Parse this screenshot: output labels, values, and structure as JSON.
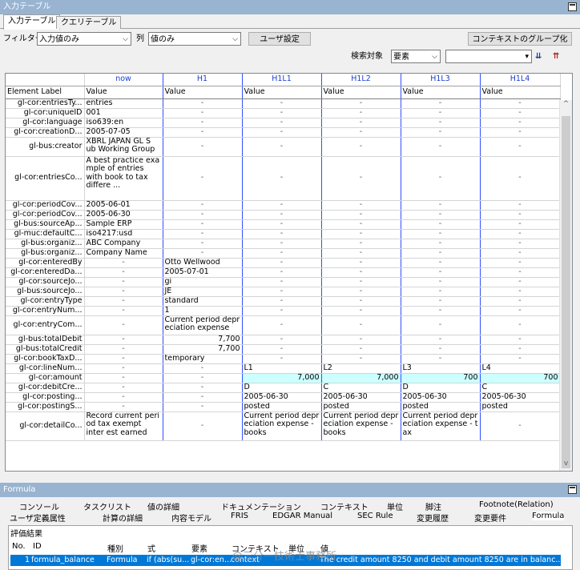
{
  "input_pane": {
    "title": "入力テーブル",
    "tabs": [
      "入力テーブル",
      "クエリテーブル"
    ],
    "filter_label": "フィルター",
    "filter_value": "入力値のみ",
    "column_label": "列",
    "column_value": "値のみ",
    "user_settings_button": "ユーザ設定",
    "context_group_button": "コンテキストのグループ化",
    "search_target_label": "検索対象",
    "search_target_value": "要素",
    "search_value": ""
  },
  "grid": {
    "top_headers": [
      "",
      "now",
      "H1",
      "H1L1",
      "H1L2",
      "H1L3",
      "H1L4"
    ],
    "sub_headers": [
      "Element Label",
      "Value",
      "Value",
      "Value",
      "Value",
      "Value",
      "Value"
    ],
    "rows": [
      {
        "label": "gl-cor:entriesTy...",
        "cells": [
          "entries",
          "-",
          "-",
          "-",
          "-",
          "-"
        ]
      },
      {
        "label": "gl-cor:uniqueID",
        "cells": [
          "001",
          "-",
          "-",
          "-",
          "-",
          "-"
        ]
      },
      {
        "label": "gl-cor:language",
        "cells": [
          "iso639:en",
          "-",
          "-",
          "-",
          "-",
          "-"
        ]
      },
      {
        "label": "gl-cor:creationD...",
        "cells": [
          "2005-07-05",
          "-",
          "-",
          "-",
          "-",
          "-"
        ]
      },
      {
        "label": "gl-bus:creator",
        "cells": [
          "XBRL JAPAN GL S ub Working Group",
          "-",
          "-",
          "-",
          "-",
          "-"
        ]
      },
      {
        "label": "gl-cor:entriesCo...",
        "cells": [
          "A best practice exa mple of entries with book to tax differe ...",
          "-",
          "-",
          "-",
          "-",
          "-"
        ]
      },
      {
        "label": "gl-cor:periodCov...",
        "cells": [
          "2005-06-01",
          "-",
          "-",
          "-",
          "-",
          "-"
        ]
      },
      {
        "label": "gl-cor:periodCov...",
        "cells": [
          "2005-06-30",
          "-",
          "-",
          "-",
          "-",
          "-"
        ]
      },
      {
        "label": "gl-bus:sourceAp...",
        "cells": [
          "Sample ERP",
          "-",
          "-",
          "-",
          "-",
          "-"
        ]
      },
      {
        "label": "gl-muc:defaultC...",
        "cells": [
          "iso4217:usd",
          "-",
          "-",
          "-",
          "-",
          "-"
        ]
      },
      {
        "label": "gl-bus:organiz...",
        "cells": [
          "ABC Company",
          "-",
          "-",
          "-",
          "-",
          "-"
        ]
      },
      {
        "label": "gl-bus:organiz...",
        "cells": [
          "Company Name",
          "-",
          "-",
          "-",
          "-",
          "-"
        ]
      },
      {
        "label": "gl-cor:enteredBy",
        "cells": [
          "-",
          "Otto Wellwood",
          "-",
          "-",
          "-",
          "-"
        ]
      },
      {
        "label": "gl-cor:enteredDa...",
        "cells": [
          "-",
          "2005-07-01",
          "-",
          "-",
          "-",
          "-"
        ]
      },
      {
        "label": "gl-cor:sourceJo...",
        "cells": [
          "-",
          "gi",
          "-",
          "-",
          "-",
          "-"
        ]
      },
      {
        "label": "gl-bus:sourceJo...",
        "cells": [
          "-",
          "JE",
          "-",
          "-",
          "-",
          "-"
        ]
      },
      {
        "label": "gl-cor:entryType",
        "cells": [
          "-",
          "standard",
          "-",
          "-",
          "-",
          "-"
        ]
      },
      {
        "label": "gl-cor:entryNum...",
        "cells": [
          "-",
          "1",
          "-",
          "-",
          "-",
          "-"
        ]
      },
      {
        "label": "gl-cor:entryCom...",
        "cells": [
          "-",
          "Current period depr eciation expense",
          "-",
          "-",
          "-",
          "-"
        ]
      },
      {
        "label": "gl-bus:totalDebit",
        "cells": [
          "-",
          "7,700",
          "-",
          "-",
          "-",
          "-"
        ]
      },
      {
        "label": "gl-bus:totalCredit",
        "cells": [
          "-",
          "7,700",
          "-",
          "-",
          "-",
          "-"
        ]
      },
      {
        "label": "gl-cor:bookTaxD...",
        "cells": [
          "-",
          "temporary",
          "-",
          "-",
          "-",
          "-"
        ]
      },
      {
        "label": "gl-cor:lineNum...",
        "cells": [
          "-",
          "-",
          "L1",
          "L2",
          "L3",
          "L4"
        ]
      },
      {
        "label": "gl-cor:amount",
        "cells": [
          "-",
          "-",
          "7,000",
          "7,000",
          "700",
          "700"
        ]
      },
      {
        "label": "gl-cor:debitCre...",
        "cells": [
          "-",
          "-",
          "D",
          "C",
          "D",
          "C"
        ]
      },
      {
        "label": "gl-cor:posting...",
        "cells": [
          "-",
          "-",
          "2005-06-30",
          "2005-06-30",
          "2005-06-30",
          "2005-06-30"
        ]
      },
      {
        "label": "gl-cor:postingS...",
        "cells": [
          "-",
          "-",
          "posted",
          "posted",
          "posted",
          "posted"
        ]
      },
      {
        "label": "gl-cor:detailCo...",
        "cells": [
          "Record current peri od tax exempt inter est earned",
          "-",
          "Current period depr eciation expense - books",
          "Current period depr eciation expense - books",
          "Current period depr eciation expense - t ax",
          "-"
        ]
      }
    ]
  },
  "formula_pane": {
    "title": "Formula",
    "tabs_row1": [
      "コンソール",
      "タスクリスト",
      "値の詳細",
      "ドキュメンテーション",
      "コンテキスト",
      "単位",
      "脚注",
      "Footnote(Relation)"
    ],
    "tabs_row2": [
      "ユーザ定義属性",
      "計算の詳細",
      "内容モデル",
      "FRIS",
      "EDGAR Manual",
      "SEC Rule",
      "変更履歴",
      "変更要件",
      "Formula"
    ],
    "results_caption": "評価結果",
    "result_headers": [
      "No.",
      "ID",
      "種別",
      "式",
      "要素",
      "コンテキスト",
      "単位",
      "値"
    ],
    "result_row": [
      "1",
      "formula_balance",
      "Formula",
      "if (abs(su...",
      "gl-cor:en...",
      "context",
      "",
      "The credit amount 8250 and debit amount 8250 are in balanc..."
    ],
    "watermark": "@三分一技術士事務所"
  }
}
